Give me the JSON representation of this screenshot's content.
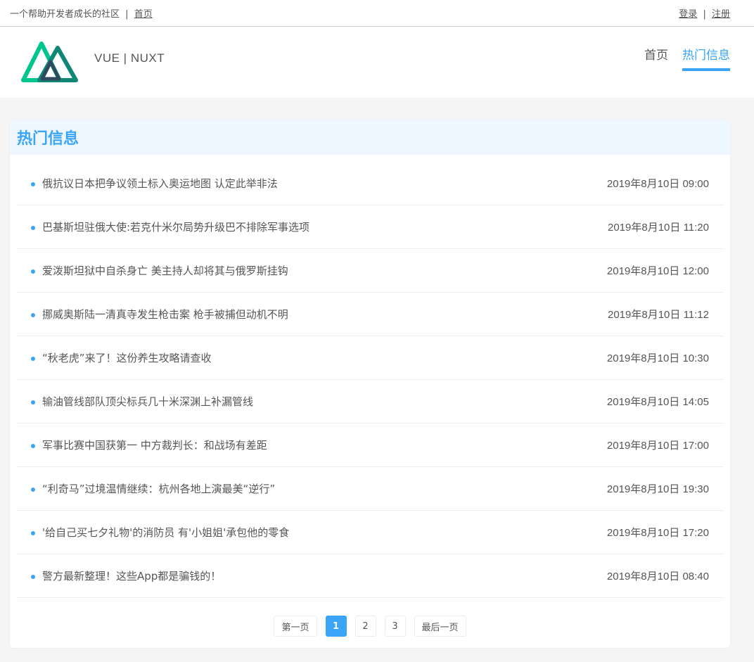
{
  "topbar": {
    "slogan": "一个帮助开发者成长的社区",
    "separator": "|",
    "home_link": "首页",
    "login": "登录",
    "register": "注册"
  },
  "header": {
    "logo_icon": "nuxt-logo-icon",
    "brand_text": "VUE | NUXT",
    "nav": [
      {
        "label": "首页",
        "active": false
      },
      {
        "label": "热门信息",
        "active": true
      }
    ]
  },
  "panel": {
    "title": "热门信息",
    "items": [
      {
        "title": "俄抗议日本把争议领土标入奥运地图 认定此举非法",
        "time": "2019年8月10日 09:00"
      },
      {
        "title": "巴基斯坦驻俄大使:若克什米尔局势升级巴不排除军事选项",
        "time": "2019年8月10日 11:20"
      },
      {
        "title": "爱泼斯坦狱中自杀身亡 美主持人却将其与俄罗斯挂钩",
        "time": "2019年8月10日 12:00"
      },
      {
        "title": "挪威奥斯陆一清真寺发生枪击案 枪手被捕但动机不明",
        "time": "2019年8月10日 11:12"
      },
      {
        "title": "“秋老虎”来了！这份养生攻略请查收",
        "time": "2019年8月10日 10:30"
      },
      {
        "title": "输油管线部队顶尖标兵几十米深渊上补漏管线",
        "time": "2019年8月10日 14:05"
      },
      {
        "title": "军事比赛中国获第一 中方裁判长：和战场有差距",
        "time": "2019年8月10日 17:00"
      },
      {
        "title": "“利奇马”过境温情继续：杭州各地上演最美“逆行”",
        "time": "2019年8月10日 19:30"
      },
      {
        "title": "'给自己买七夕礼物'的消防员 有'小姐姐'承包他的零食",
        "time": "2019年8月10日 17:20"
      },
      {
        "title": "警方最新整理！这些App都是骗钱的！",
        "time": "2019年8月10日 08:40"
      }
    ]
  },
  "pagination": {
    "first": "第一页",
    "pages": [
      "1",
      "2",
      "3"
    ],
    "current": "1",
    "last": "最后一页"
  },
  "colors": {
    "accent": "#3aa4f7",
    "logo_green": "#00c58e",
    "logo_dark": "#2f495e"
  }
}
